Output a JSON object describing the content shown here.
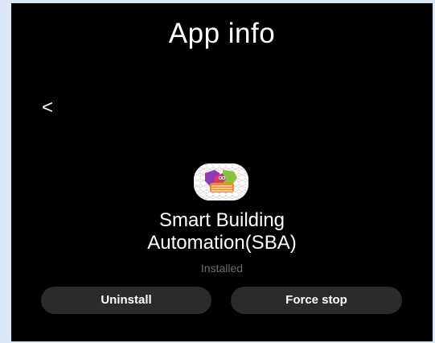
{
  "header": {
    "title": "App info",
    "back_glyph": "<"
  },
  "app": {
    "icon": "smart-building-app-icon",
    "name_line1": "Smart Building",
    "name_line2": "Automation(SBA)",
    "status": "Installed"
  },
  "actions": {
    "uninstall_label": "Uninstall",
    "force_stop_label": "Force stop"
  },
  "colors": {
    "screen_background": "#000000",
    "frame_background": "#dbe9f6",
    "button_background": "#2b2b2b",
    "status_text": "#6d6d6d"
  }
}
